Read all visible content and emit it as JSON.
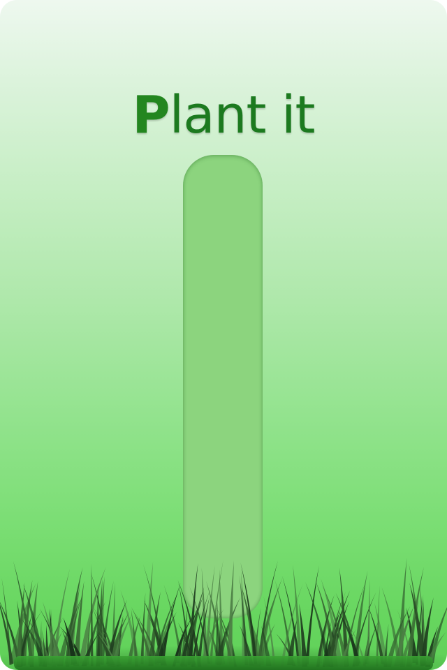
{
  "app": {
    "title_first_letter": "P",
    "title_rest": "lant it"
  },
  "plant_tube": {
    "fill_fraction": 0.0
  },
  "colors": {
    "title": "#1c7a1f",
    "tube": "#8cd47e",
    "grass_dark": "#1f3d1f",
    "grass_mid": "#3b6b35",
    "ground": "#2f8f2a"
  },
  "decor": {
    "grass_icon": "grass-icon"
  }
}
